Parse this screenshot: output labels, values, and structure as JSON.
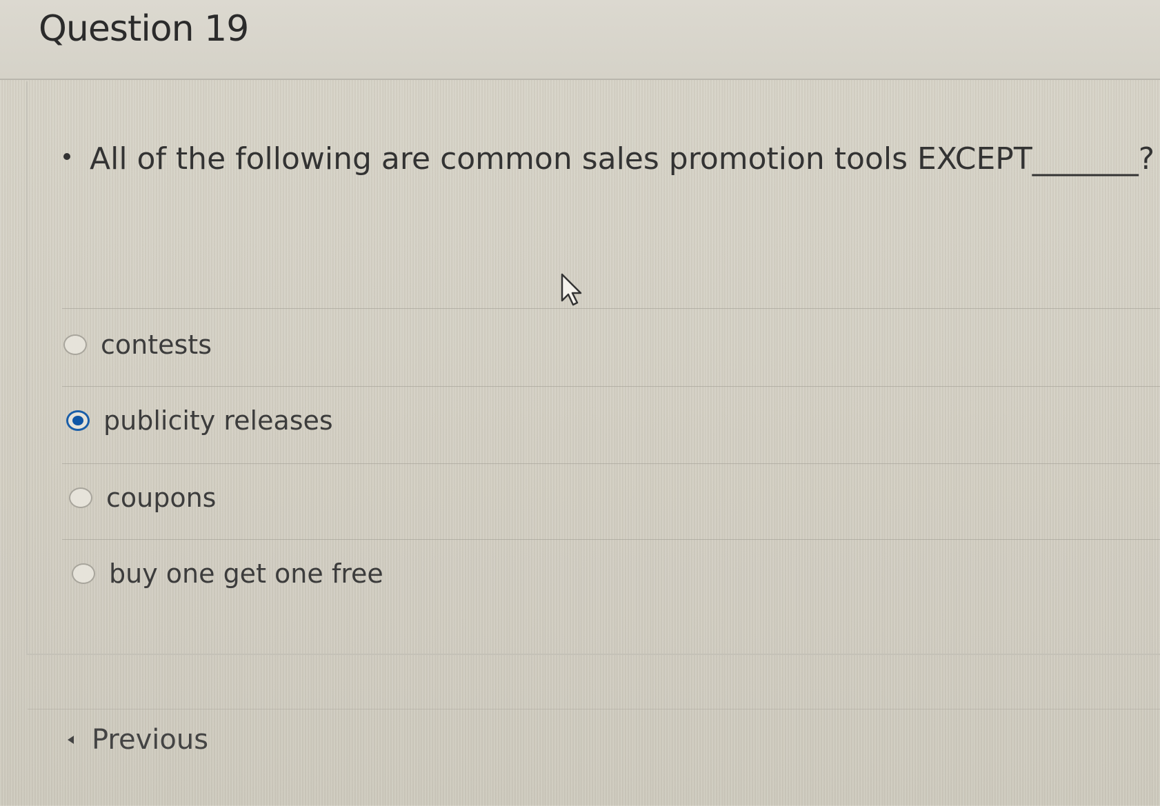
{
  "header": {
    "title": "Question 19"
  },
  "question": {
    "text": "All of the following are common sales promotion tools EXCEPT_______?"
  },
  "options": [
    {
      "label": "contests",
      "selected": false
    },
    {
      "label": "publicity releases",
      "selected": true
    },
    {
      "label": "coupons",
      "selected": false
    },
    {
      "label": "buy one get one free",
      "selected": false
    }
  ],
  "navigation": {
    "previous_label": "Previous"
  },
  "colors": {
    "selected_radio": "#0f56a6",
    "text": "#3a3a3a"
  }
}
